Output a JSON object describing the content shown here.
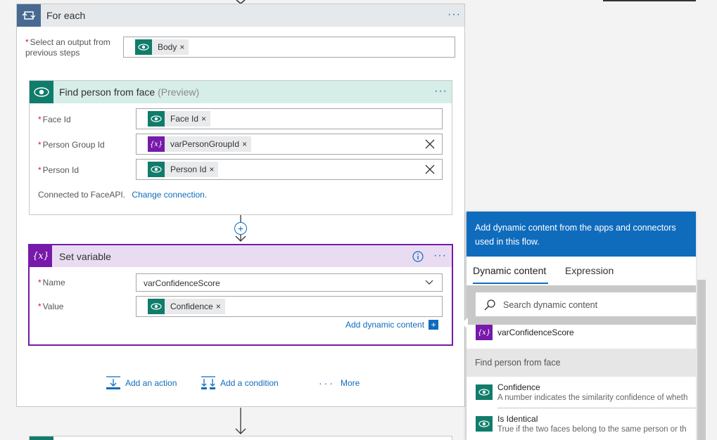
{
  "for_each": {
    "title": "For each",
    "output_label": "Select an output from previous steps",
    "output_token": "Body"
  },
  "find_person": {
    "title": "Find person from face",
    "preview": "(Preview)",
    "fields": [
      {
        "label": "Face Id",
        "token": "Face Id"
      },
      {
        "label": "Person Group Id",
        "token": "varPersonGroupId"
      },
      {
        "label": "Person Id",
        "token": "Person Id"
      }
    ],
    "connected_text": "Connected to FaceAPI.",
    "change_connection": "Change connection."
  },
  "set_variable": {
    "title": "Set variable",
    "name_label": "Name",
    "name_value": "varConfidenceScore",
    "value_label": "Value",
    "value_token": "Confidence",
    "add_dynamic": "Add dynamic content"
  },
  "actions": {
    "add_action": "Add an action",
    "add_condition": "Add a condition",
    "more": "More"
  },
  "dynamic_panel": {
    "header": "Add dynamic content from the apps and connectors used in this flow.",
    "tab_dynamic": "Dynamic content",
    "tab_expression": "Expression",
    "search_placeholder": "Search dynamic content",
    "var_item": "varConfidenceScore",
    "group_title": "Find person from face",
    "items": [
      {
        "title": "Confidence",
        "desc": "A number indicates the similarity confidence of wheth"
      },
      {
        "title": "Is Identical",
        "desc": "True if the two faces belong to the same person or th"
      }
    ]
  },
  "colors": {
    "accent": "#0f6cbd",
    "teal": "#107c6b",
    "purple": "#7719aa",
    "loop": "#486991"
  }
}
